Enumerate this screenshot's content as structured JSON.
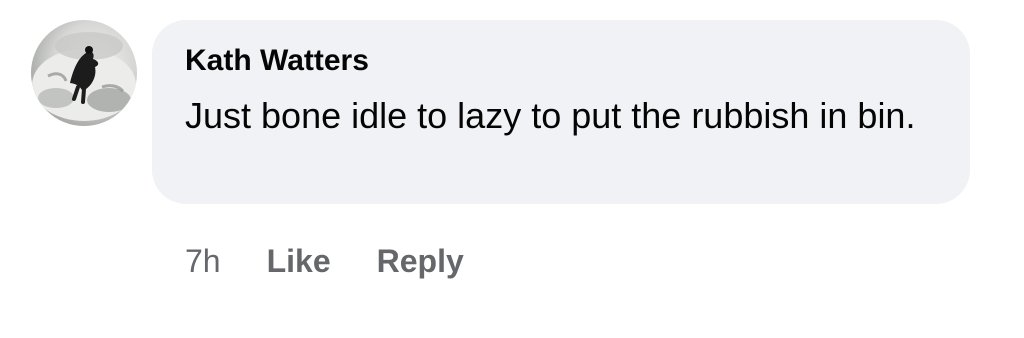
{
  "comment": {
    "author": "Kath Watters",
    "text": "Just bone idle to lazy to put the rubbish in bin.",
    "time": "7h",
    "like_label": "Like",
    "reply_label": "Reply"
  },
  "colors": {
    "bubble_bg": "#f0f2f5",
    "text": "#050505",
    "meta_text": "#65676b"
  },
  "icons": {
    "avatar": "dog-on-snow-profile-photo"
  }
}
